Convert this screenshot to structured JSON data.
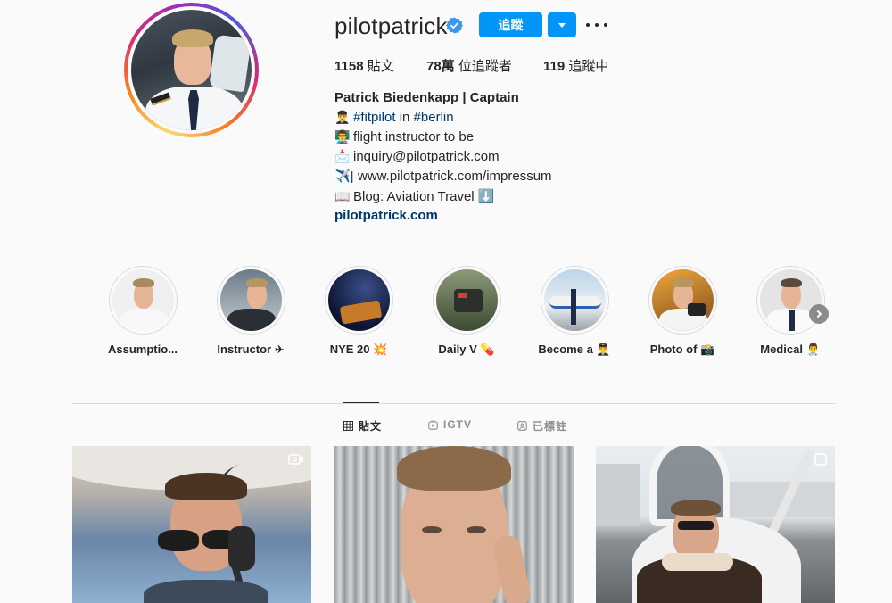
{
  "profile": {
    "username": "pilotpatrick",
    "follow_label": "追蹤",
    "posts_count": "1158",
    "posts_label": " 貼文",
    "followers_count": "78萬",
    "followers_label": " 位追蹤者",
    "following_count": "119",
    "following_label": " 追蹤中",
    "full_name": "Patrick Biedenkapp | Captain",
    "bio": {
      "line1_emoji": "👨‍✈️",
      "line1_tag1": "#fitpilot",
      "line1_mid": " in ",
      "line1_tag2": "#berlin",
      "line2_emoji": "👨‍🏫",
      "line2_text": "flight instructor to be",
      "line3_emoji": "📩",
      "line3_text": "inquiry@pilotpatrick.com",
      "line4_emoji": "✈️|",
      "line4_text": "www.pilotpatrick.com/impressum",
      "line5_emoji": "📖",
      "line5_text": "Blog: Aviation Travel ⬇️"
    },
    "website": "pilotpatrick.com"
  },
  "highlights": [
    {
      "label": "Assumptio..."
    },
    {
      "label": "Instructor ✈"
    },
    {
      "label": "NYE 20 💥"
    },
    {
      "label": "Daily V 💊"
    },
    {
      "label": "Become a 👨‍✈️"
    },
    {
      "label": "Photo of 📸"
    },
    {
      "label": "Medical 👨‍⚕️"
    }
  ],
  "tabs": [
    {
      "label": "貼文",
      "active": true
    },
    {
      "label": "IGTV",
      "active": false
    },
    {
      "label": "已標註",
      "active": false
    }
  ],
  "icons": {
    "verified": "verified-badge-icon",
    "dropdown": "chevron-down-icon",
    "more": "more-options-icon",
    "grid": "grid-icon",
    "igtv": "igtv-icon",
    "tagged": "tagged-icon",
    "next": "chevron-right-icon",
    "post_video": "video-icon",
    "post_carousel": "carousel-icon"
  },
  "colors": {
    "accent": "#0095f6",
    "link": "#00376b",
    "text": "#262626",
    "muted": "#8e8e8e",
    "background": "#fafafa"
  }
}
